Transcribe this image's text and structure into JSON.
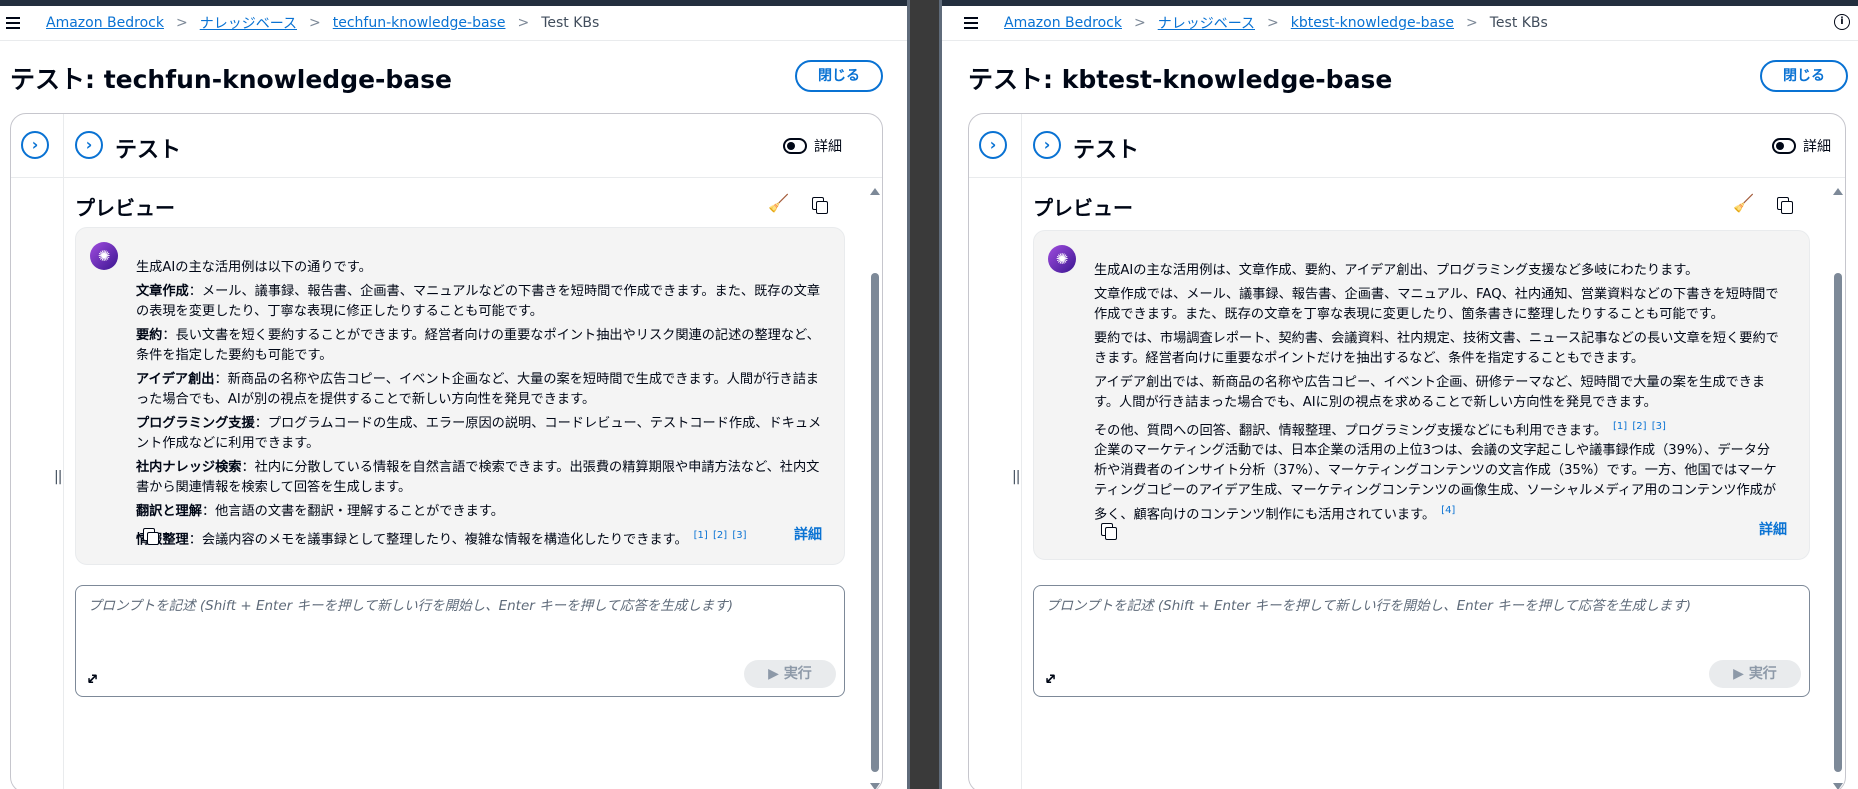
{
  "left": {
    "breadcrumbs": [
      "Amazon Bedrock",
      "ナレッジベース",
      "techfun-knowledge-base",
      "Test KBs"
    ],
    "page_title": "テスト: techfun-knowledge-base",
    "close_label": "閉じる",
    "panel_title": "テスト",
    "toggle_label": "詳細",
    "preview_title": "プレビュー",
    "message": {
      "intro": "生成AIの主な活用例は以下の通りです。",
      "items": [
        {
          "term": "文章作成",
          "text": "：メール、議事録、報告書、企画書、マニュアルなどの下書きを短時間で作成できます。また、既存の文章の表現を変更したり、丁寧な表現に修正したりすることも可能です。"
        },
        {
          "term": "要約",
          "text": "：長い文書を短く要約することができます。経営者向けの重要なポイント抽出やリスク関連の記述の整理など、条件を指定した要約も可能です。"
        },
        {
          "term": "アイデア創出",
          "text": "：新商品の名称や広告コピー、イベント企画など、大量の案を短時間で生成できます。人間が行き詰まった場合でも、AIが別の視点を提供することで新しい方向性を発見できます。"
        },
        {
          "term": "プログラミング支援",
          "text": "：プログラムコードの生成、エラー原因の説明、コードレビュー、テストコード作成、ドキュメント作成などに利用できます。"
        },
        {
          "term": "社内ナレッジ検索",
          "text": "：社内に分散している情報を自然言語で検索できます。出張費の精算期限や申請方法など、社内文書から関連情報を検索して回答を生成します。"
        },
        {
          "term": "翻訳と理解",
          "text": "：他言語の文書を翻訳・理解することができます。"
        },
        {
          "term": "情報整理",
          "text": "：会議内容のメモを議事録として整理したり、複雑な情報を構造化したりできます。"
        }
      ],
      "citations": "[1] [2] [3]",
      "detail_label": "詳細"
    },
    "prompt_placeholder": "プロンプトを記述 (Shift + Enter キーを押して新しい行を開始し、Enter キーを押して応答を生成します)",
    "run_label": "実行"
  },
  "right": {
    "breadcrumbs": [
      "Amazon Bedrock",
      "ナレッジベース",
      "kbtest-knowledge-base",
      "Test KBs"
    ],
    "page_title": "テスト: kbtest-knowledge-base",
    "close_label": "閉じる",
    "panel_title": "テスト",
    "toggle_label": "詳細",
    "preview_title": "プレビュー",
    "message": {
      "p1": "生成AIの主な活用例は、文章作成、要約、アイデア創出、プログラミング支援など多岐にわたります。",
      "p2": "文章作成では、メール、議事録、報告書、企画書、マニュアル、FAQ、社内通知、営業資料などの下書きを短時間で作成できます。また、既存の文章を丁寧な表現に変更したり、箇条書きに整理したりすることも可能です。",
      "p3": "要約では、市場調査レポート、契約書、会議資料、社内規定、技術文書、ニュース記事などの長い文章を短く要約できます。経営者向けに重要なポイントだけを抽出するなど、条件を指定することもできます。",
      "p4": "アイデア創出では、新商品の名称や広告コピー、イベント企画、研修テーマなど、短時間で大量の案を生成できます。人間が行き詰まった場合でも、AIに別の視点を求めることで新しい方向性を発見できます。",
      "p5": "その他、質問への回答、翻訳、情報整理、プログラミング支援などにも利用できます。",
      "p5_citations": "[1] [2] [3]",
      "p6": "企業のマーケティング活動では、日本企業の活用の上位3つは、会議の文字起こしや議事録作成（39%）、データ分析や消費者のインサイト分析（37%）、マーケティングコンテンツの文言作成（35%）です。一方、他国ではマーケティングコピーのアイデア生成、マーケティングコンテンツの画像生成、ソーシャルメディア用のコンテンツ作成が多く、顧客向けのコンテンツ制作にも活用されています。",
      "p6_citations": "[4]",
      "detail_label": "詳細"
    },
    "prompt_placeholder": "プロンプトを記述 (Shift + Enter キーを押して新しい行を開始し、Enter キーを押して応答を生成します)",
    "run_label": "実行"
  },
  "icons": {
    "menu": "hamburger-menu-icon",
    "info": "info-icon",
    "chevron": "chevron-right-circle-icon",
    "brush": "clear-brush-icon",
    "copy": "copy-icon",
    "expand": "expand-arrows-icon",
    "run": "play-icon",
    "avatar": "ai-brain-avatar-icon"
  },
  "colors": {
    "link": "#0972d3",
    "text": "#000716",
    "message_bg": "#f4f4f4",
    "avatar": "#7b2fd0"
  }
}
